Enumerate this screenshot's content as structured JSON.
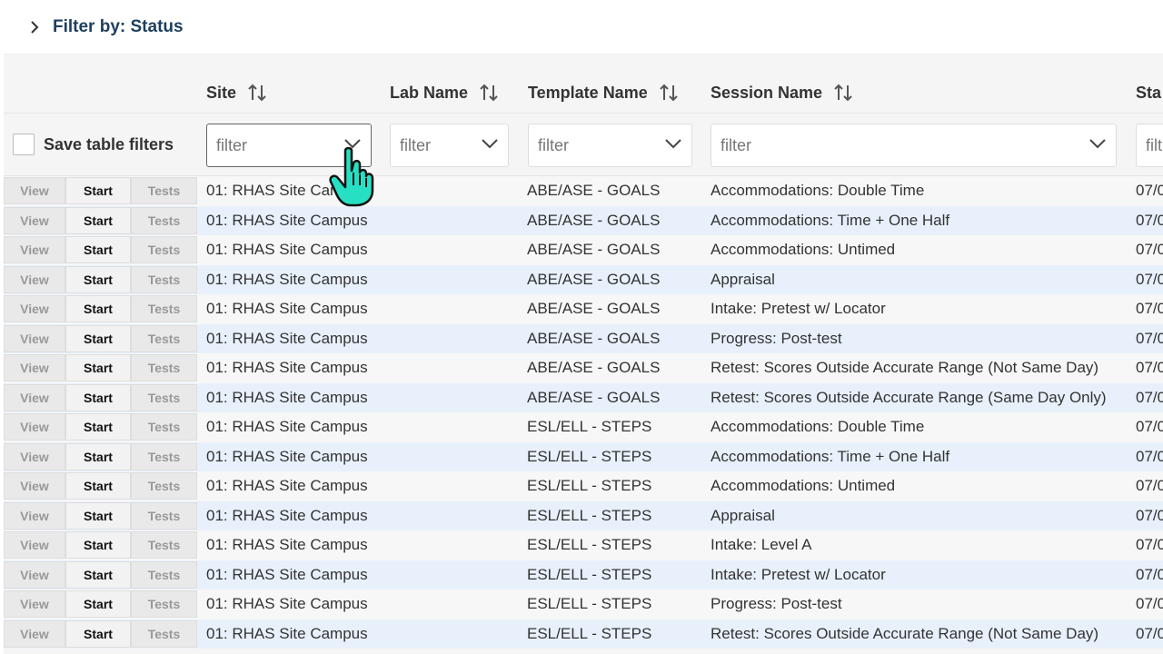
{
  "filter_bar": {
    "title": "Filter by: Status"
  },
  "columns": [
    {
      "label": "Site"
    },
    {
      "label": "Lab Name"
    },
    {
      "label": "Template Name"
    },
    {
      "label": "Session Name"
    },
    {
      "label": "Sta"
    }
  ],
  "save_filters_label": "Save table filters",
  "filter_placeholder": "filter",
  "filter_placeholder_partial": "filt",
  "row_buttons": {
    "view": "View",
    "start": "Start",
    "tests": "Tests"
  },
  "rows": [
    {
      "site": "01: RHAS Site Campus",
      "lab": "",
      "template": "ABE/ASE - GOALS",
      "session": "Accommodations: Double Time",
      "status": "07/0"
    },
    {
      "site": "01: RHAS Site Campus",
      "lab": "",
      "template": "ABE/ASE - GOALS",
      "session": "Accommodations: Time + One Half",
      "status": "07/0"
    },
    {
      "site": "01: RHAS Site Campus",
      "lab": "",
      "template": "ABE/ASE - GOALS",
      "session": "Accommodations: Untimed",
      "status": "07/0"
    },
    {
      "site": "01: RHAS Site Campus",
      "lab": "",
      "template": "ABE/ASE - GOALS",
      "session": "Appraisal",
      "status": "07/0"
    },
    {
      "site": "01: RHAS Site Campus",
      "lab": "",
      "template": "ABE/ASE - GOALS",
      "session": "Intake: Pretest w/ Locator",
      "status": "07/0"
    },
    {
      "site": "01: RHAS Site Campus",
      "lab": "",
      "template": "ABE/ASE - GOALS",
      "session": "Progress: Post-test",
      "status": "07/0"
    },
    {
      "site": "01: RHAS Site Campus",
      "lab": "",
      "template": "ABE/ASE - GOALS",
      "session": "Retest: Scores Outside Accurate Range (Not Same Day)",
      "status": "07/0"
    },
    {
      "site": "01: RHAS Site Campus",
      "lab": "",
      "template": "ABE/ASE - GOALS",
      "session": "Retest: Scores Outside Accurate Range (Same Day Only)",
      "status": "07/0"
    },
    {
      "site": "01: RHAS Site Campus",
      "lab": "",
      "template": "ESL/ELL - STEPS",
      "session": "Accommodations: Double Time",
      "status": "07/0"
    },
    {
      "site": "01: RHAS Site Campus",
      "lab": "",
      "template": "ESL/ELL - STEPS",
      "session": "Accommodations: Time + One Half",
      "status": "07/0"
    },
    {
      "site": "01: RHAS Site Campus",
      "lab": "",
      "template": "ESL/ELL - STEPS",
      "session": "Accommodations: Untimed",
      "status": "07/0"
    },
    {
      "site": "01: RHAS Site Campus",
      "lab": "",
      "template": "ESL/ELL - STEPS",
      "session": "Appraisal",
      "status": "07/0"
    },
    {
      "site": "01: RHAS Site Campus",
      "lab": "",
      "template": "ESL/ELL - STEPS",
      "session": "Intake: Level A",
      "status": "07/0"
    },
    {
      "site": "01: RHAS Site Campus",
      "lab": "",
      "template": "ESL/ELL - STEPS",
      "session": "Intake: Pretest w/ Locator",
      "status": "07/0"
    },
    {
      "site": "01: RHAS Site Campus",
      "lab": "",
      "template": "ESL/ELL - STEPS",
      "session": "Progress: Post-test",
      "status": "07/0"
    },
    {
      "site": "01: RHAS Site Campus",
      "lab": "",
      "template": "ESL/ELL - STEPS",
      "session": "Retest: Scores Outside Accurate Range (Not Same Day)",
      "status": "07/0"
    }
  ],
  "icons": {
    "expand": "chevron-right-icon",
    "sort": "sort-arrows-icon",
    "dropdown": "chevron-down-icon",
    "cursor": "hand-pointer-cursor-icon"
  },
  "colors": {
    "title": "#1d3f5e",
    "row_alt": "#e8f1fb",
    "cursor_fill": "#27e0c4"
  }
}
